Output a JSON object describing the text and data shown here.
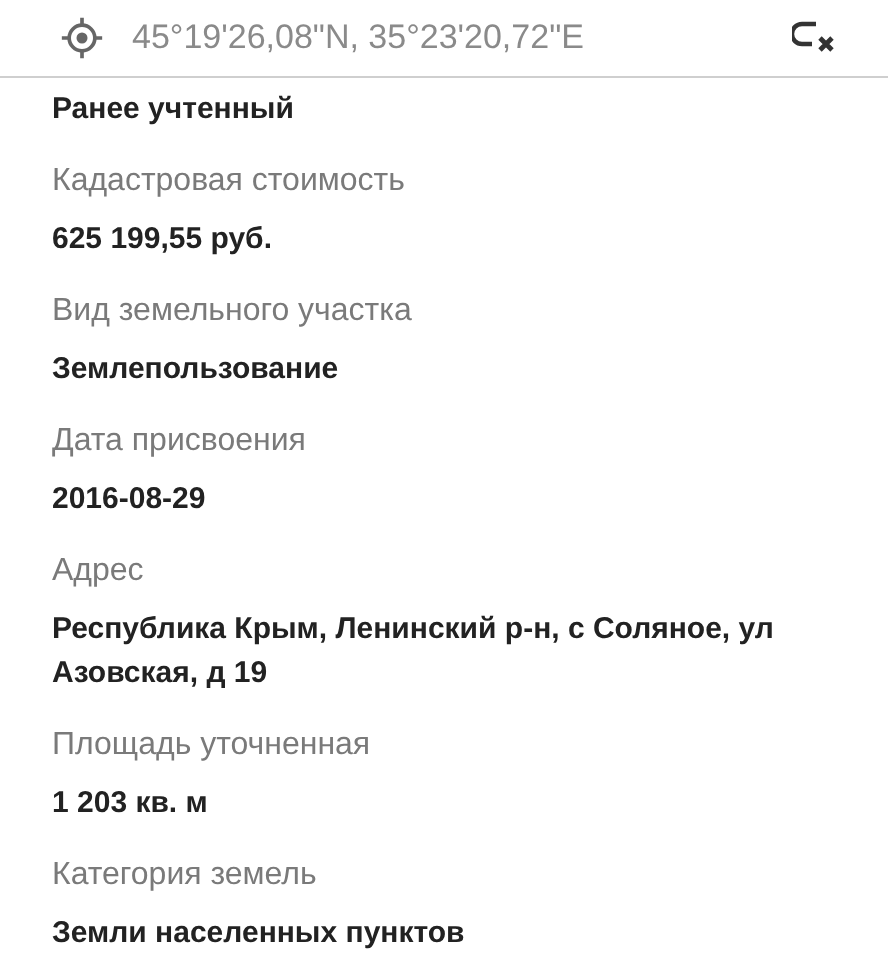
{
  "header": {
    "coordinates": "45°19'26,08\"N, 35°23'20,72\"E"
  },
  "fields": [
    {
      "value": "Ранее учтенный"
    },
    {
      "label": "Кадастровая стоимость",
      "value": "625 199,55 руб."
    },
    {
      "label": "Вид земельного участка",
      "value": "Землепользование"
    },
    {
      "label": "Дата присвоения",
      "value": "2016-08-29"
    },
    {
      "label": "Адрес",
      "value": "Республика Крым, Ленинский р-н, с Соляное, ул Азовская, д 19"
    },
    {
      "label": "Площадь уточненная",
      "value": "1 203 кв. м"
    },
    {
      "label": "Категория земель",
      "value": "Земли населенных пунктов"
    }
  ]
}
